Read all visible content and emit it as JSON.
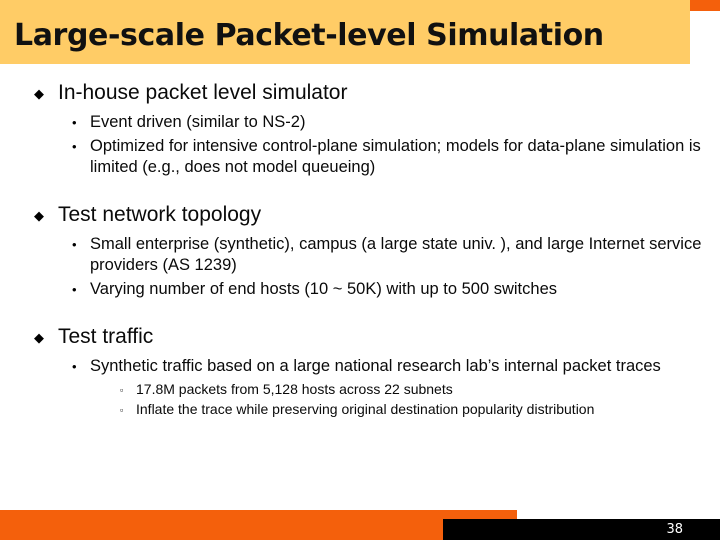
{
  "slide": {
    "title": "Large-scale Packet-level Simulation",
    "page_number": "38",
    "colors": {
      "accent_orange": "#F4600C",
      "title_band": "#FFCC66",
      "footer_black": "#000000",
      "text": "#0A0A0A",
      "background": "#FFFFFF"
    },
    "bullet_glyphs": {
      "level1": "◆",
      "level2": "•",
      "level3": "▫"
    },
    "content": [
      {
        "heading": "In-house packet level simulator",
        "items": [
          {
            "text": "Event driven (similar to NS-2)",
            "subitems": []
          },
          {
            "text": "Optimized for intensive control-plane simulation; models for data-plane simulation is limited (e.g., does not model queueing)",
            "subitems": []
          }
        ]
      },
      {
        "heading": "Test network topology",
        "items": [
          {
            "text": "Small enterprise (synthetic), campus (a large state univ. ), and large Internet service providers (AS 1239)",
            "subitems": []
          },
          {
            "text": "Varying number of end hosts (10 ~ 50K) with up to 500 switches",
            "subitems": []
          }
        ]
      },
      {
        "heading": "Test traffic",
        "items": [
          {
            "text": "Synthetic traffic based on a large national research lab’s internal packet traces",
            "subitems": [
              "17.8M packets from 5,128 hosts across 22 subnets",
              "Inflate the trace while preserving original destination popularity distribution"
            ]
          }
        ]
      }
    ]
  }
}
